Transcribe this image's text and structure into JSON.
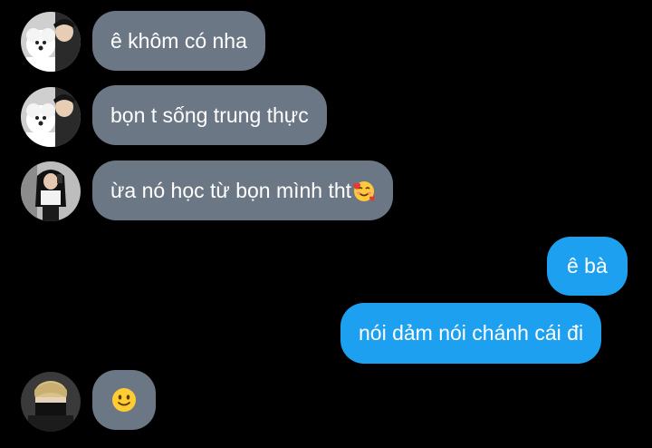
{
  "chat": {
    "colors": {
      "background": "#000000",
      "incoming_bubble": "#6b7785",
      "outgoing_bubble": "#1ea0f0",
      "text": "#ffffff"
    },
    "messages": [
      {
        "direction": "incoming",
        "sender_avatar": "avatar-boy-with-dog",
        "text": "ê khôm có nha"
      },
      {
        "direction": "incoming",
        "sender_avatar": "avatar-boy-with-dog",
        "text": "bọn t sống trung thực"
      },
      {
        "direction": "incoming",
        "sender_avatar": "avatar-girl-mirror-selfie",
        "text": "ừa nó học từ bọn mình tht",
        "emoji": "smiling-face-with-hearts"
      },
      {
        "direction": "outgoing",
        "text": "ê bà"
      },
      {
        "direction": "outgoing",
        "text": "nói dảm nói chánh cái đi"
      },
      {
        "direction": "incoming",
        "sender_avatar": "avatar-masked-person",
        "emoji": "slightly-smiling-face"
      }
    ]
  }
}
